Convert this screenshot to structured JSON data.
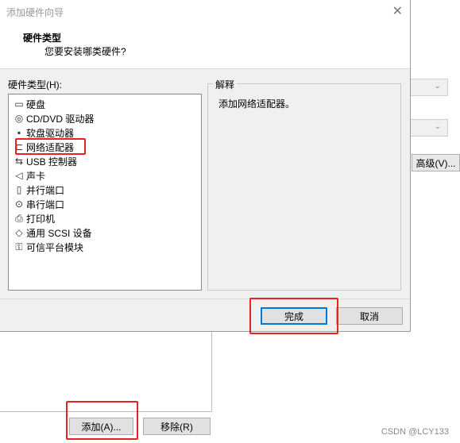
{
  "dialog": {
    "title": "添加硬件向导",
    "header_title": "硬件类型",
    "header_subtitle": "您要安装哪类硬件?",
    "list_label": "硬件类型(H):",
    "items": [
      {
        "label": "硬盘",
        "icon": "hard-disk-icon"
      },
      {
        "label": "CD/DVD 驱动器",
        "icon": "cd-dvd-icon"
      },
      {
        "label": "软盘驱动器",
        "icon": "floppy-icon"
      },
      {
        "label": "网络适配器",
        "icon": "network-adapter-icon"
      },
      {
        "label": "USB 控制器",
        "icon": "usb-icon"
      },
      {
        "label": "声卡",
        "icon": "speaker-icon"
      },
      {
        "label": "并行端口",
        "icon": "parallel-port-icon"
      },
      {
        "label": "串行端口",
        "icon": "serial-port-icon"
      },
      {
        "label": "打印机",
        "icon": "printer-icon"
      },
      {
        "label": "通用 SCSI 设备",
        "icon": "scsi-icon"
      },
      {
        "label": "可信平台模块",
        "icon": "tpm-icon"
      }
    ],
    "explain_legend": "解释",
    "explain_text": "添加网络适配器。",
    "finish_button": "完成",
    "cancel_button": "取消"
  },
  "background": {
    "advanced_button": "高级(V)...",
    "add_button": "添加(A)...",
    "remove_button": "移除(R)",
    "watermark": "CSDN @LCY133"
  },
  "colors": {
    "highlight": "#e8231f",
    "focus": "#0078d7"
  }
}
